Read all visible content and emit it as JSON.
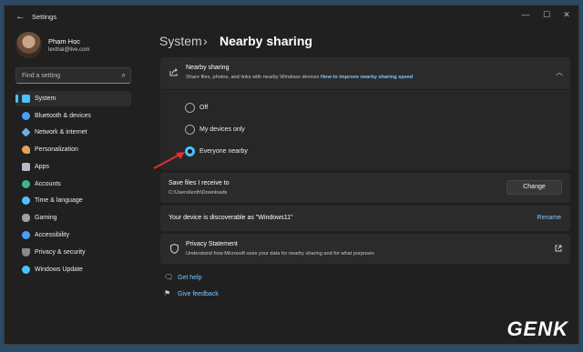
{
  "window": {
    "title": "Settings",
    "back_icon": "back-arrow-icon"
  },
  "profile": {
    "name": "Phạm Học",
    "email": "lexthai@live.com"
  },
  "search": {
    "placeholder": "Find a setting",
    "icon": "search-icon"
  },
  "sidebar": {
    "items": [
      {
        "label": "System",
        "icon": "system-icon",
        "color": "#4cc2ff",
        "active": true
      },
      {
        "label": "Bluetooth & devices",
        "icon": "bluetooth-icon",
        "color": "#4c9bff"
      },
      {
        "label": "Network & internet",
        "icon": "network-icon",
        "color": "#6ab0e8"
      },
      {
        "label": "Personalization",
        "icon": "brush-icon",
        "color": "#e6a15a"
      },
      {
        "label": "Apps",
        "icon": "apps-icon",
        "color": "#b8b8c8"
      },
      {
        "label": "Accounts",
        "icon": "accounts-icon",
        "color": "#3fb68b"
      },
      {
        "label": "Time & language",
        "icon": "time-icon",
        "color": "#4cc2ff"
      },
      {
        "label": "Gaming",
        "icon": "gaming-icon",
        "color": "#a0a0a0"
      },
      {
        "label": "Accessibility",
        "icon": "accessibility-icon",
        "color": "#4c9bff"
      },
      {
        "label": "Privacy & security",
        "icon": "shield-icon",
        "color": "#8a8a8a"
      },
      {
        "label": "Windows Update",
        "icon": "update-icon",
        "color": "#4cc2ff"
      }
    ]
  },
  "breadcrumb": {
    "root": "System",
    "separator": "›",
    "current": "Nearby sharing"
  },
  "nearby": {
    "title": "Nearby sharing",
    "description": "Share files, photos, and links with nearby Windows devices",
    "link": "How to improve nearby sharing speed",
    "options": [
      {
        "label": "Off",
        "checked": false
      },
      {
        "label": "My devices only",
        "checked": false
      },
      {
        "label": "Everyone nearby",
        "checked": true
      }
    ]
  },
  "save_files": {
    "title": "Save files I receive to",
    "path": "C:\\Users\\lexth\\Downloads",
    "button": "Change"
  },
  "discoverable": {
    "text": "Your device is discoverable as \"Windows11\"",
    "link": "Rename"
  },
  "privacy": {
    "title": "Privacy Statement",
    "description": "Understand how Microsoft uses your data for nearby sharing and for what purposes"
  },
  "footer_links": {
    "help": "Get help",
    "feedback": "Give feedback"
  },
  "watermark": "GENK"
}
